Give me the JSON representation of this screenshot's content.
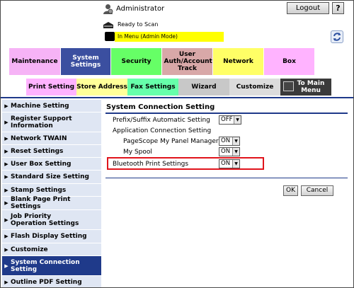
{
  "header": {
    "user_label": "Administrator",
    "logout_label": "Logout",
    "help_label": "?",
    "status_text": "Ready to Scan",
    "mode_text": "In Menu (Admin Mode)"
  },
  "main_tabs": [
    {
      "label": "Maintenance",
      "color": "#f6b3f6"
    },
    {
      "label": "System Settings",
      "color": "#3b4fa0",
      "active": true
    },
    {
      "label": "Security",
      "color": "#66ff66"
    },
    {
      "label": "User Auth/Account Track",
      "color": "#d8a8a8"
    },
    {
      "label": "Network",
      "color": "#ffff66"
    },
    {
      "label": "Box",
      "color": "#ffb3ff"
    }
  ],
  "sub_tabs": [
    {
      "label": "Print Setting",
      "color": "#ffb3ff"
    },
    {
      "label": "Store Address",
      "color": "#ffff99"
    },
    {
      "label": "Fax Settings",
      "color": "#66ffaa"
    },
    {
      "label": "Wizard",
      "color": "#c8c8c8"
    },
    {
      "label": "Customize",
      "color": "#dcdcdc"
    },
    {
      "label": "To Main Menu",
      "color": "#3a3a3a"
    }
  ],
  "sidebar": {
    "items": [
      {
        "label": "Machine Setting"
      },
      {
        "label": "Register Support Information"
      },
      {
        "label": "Network TWAIN"
      },
      {
        "label": "Reset Settings"
      },
      {
        "label": "User Box Setting"
      },
      {
        "label": "Standard Size Setting"
      },
      {
        "label": "Stamp Settings"
      },
      {
        "label": "Blank Page Print Settings"
      },
      {
        "label": "Job Priority Operation Settings"
      },
      {
        "label": "Flash Display Setting"
      },
      {
        "label": "Customize"
      },
      {
        "label": "System Connection Setting",
        "active": true
      },
      {
        "label": "Outline PDF Setting"
      }
    ]
  },
  "content": {
    "title": "System Connection Setting",
    "prefix_label": "Prefix/Suffix Automatic Setting",
    "prefix_value": "OFF",
    "app_conn_label": "Application Connection Setting",
    "pagescope_label": "PageScope My Panel Manager",
    "pagescope_value": "ON",
    "myspool_label": "My Spool",
    "myspool_value": "ON",
    "bluetooth_label": "Bluetooth Print Settings",
    "bluetooth_value": "ON",
    "ok_label": "OK",
    "cancel_label": "Cancel"
  },
  "colors": {
    "accent": "#1f3a8a",
    "highlight": "#e0141c"
  }
}
